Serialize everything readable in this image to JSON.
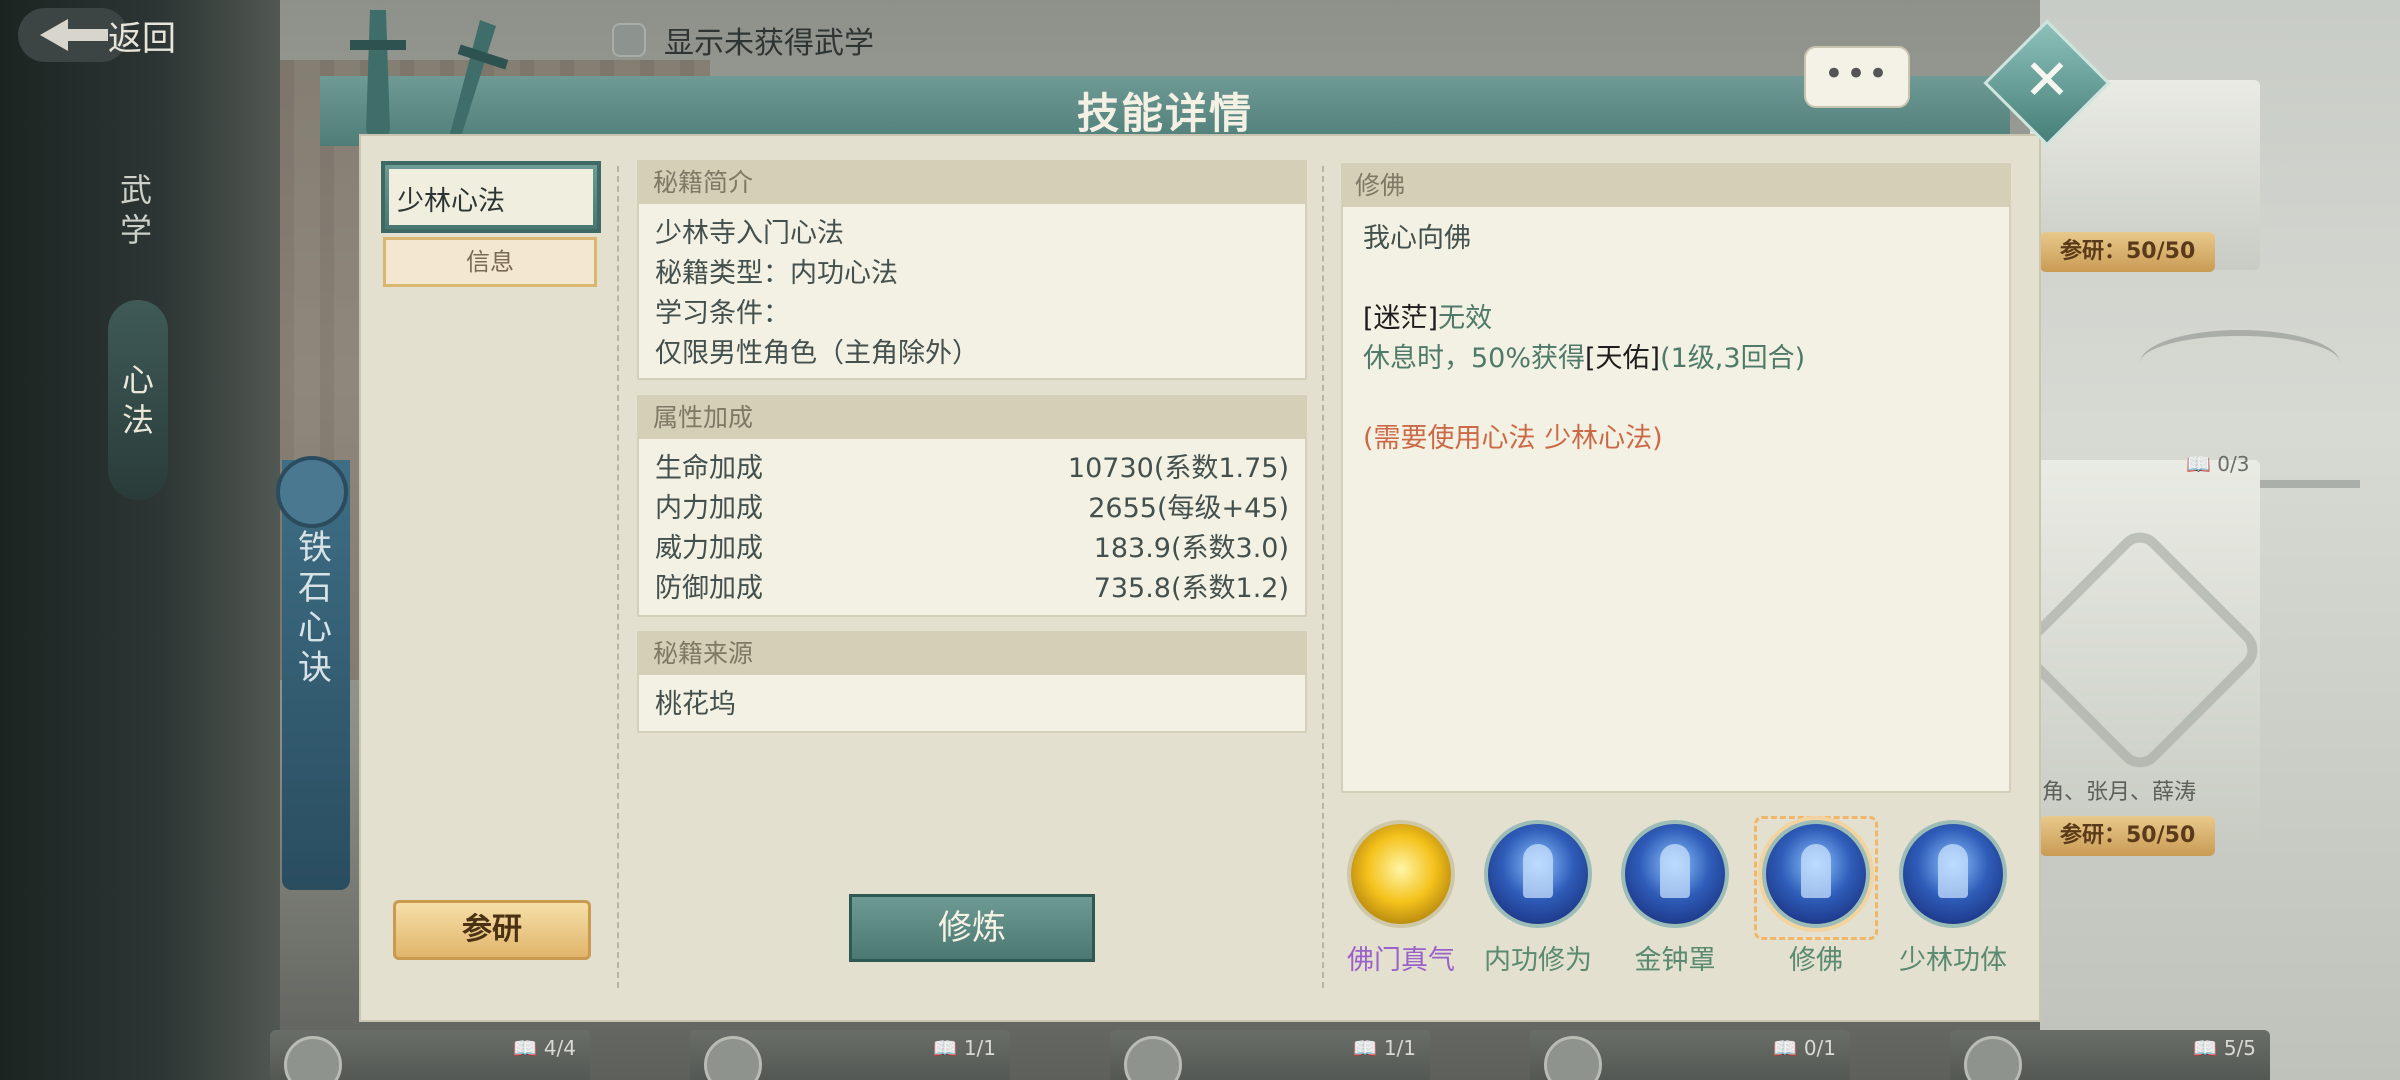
{
  "topbar": {
    "back_label": "返回",
    "toggle_label": "显示未获得武学"
  },
  "left_nav": {
    "items": [
      "武",
      "学"
    ],
    "active": [
      "心",
      "法"
    ]
  },
  "left_card": {
    "name_chars": [
      "铁",
      "石",
      "心",
      "诀"
    ]
  },
  "background_cards": {
    "card1_badge": "参研：50/50",
    "card2_count": "0/3",
    "card2_names": "角、张月、薛涛",
    "card2_badge": "参研：50/50",
    "bottom_counts": [
      "4/4",
      "1/1",
      "1/1",
      "0/1",
      "5/5"
    ]
  },
  "dialog": {
    "title": "技能详情",
    "tabs": {
      "skill": "少林心法",
      "info": "信息"
    },
    "canyan_button": "参研",
    "xiulian_button": "修炼",
    "intro": {
      "header": "秘籍简介",
      "lines": [
        "少林寺入门心法",
        "秘籍类型：内功心法",
        "学习条件：",
        "仅限男性角色（主角除外）"
      ]
    },
    "attributes": {
      "header": "属性加成",
      "rows": [
        {
          "label": "生命加成",
          "value": "10730",
          "note": "(系数1.75)"
        },
        {
          "label": "内力加成",
          "value": "2655",
          "note": "(每级+45)"
        },
        {
          "label": "威力加成",
          "value": "183.9",
          "note": "(系数3.0)"
        },
        {
          "label": "防御加成",
          "value": "735.8",
          "note": "(系数1.2)"
        }
      ]
    },
    "source": {
      "header": "秘籍来源",
      "value": "桃花坞"
    },
    "detail": {
      "header": "修佛",
      "line1": "我心向佛",
      "line3_bracket": "[迷茫]",
      "line3_rest": "无效",
      "line4_pre": "休息时，50%获得",
      "line4_bracket": "[天佑]",
      "line4_post": "(1级,3回合)",
      "requirement": "(需要使用心法 少林心法)"
    },
    "skills": [
      {
        "label": "佛门真气",
        "icon": "golden-orb-icon"
      },
      {
        "label": "内功修为",
        "icon": "meditation-icon"
      },
      {
        "label": "金钟罩",
        "icon": "meditation-icon"
      },
      {
        "label": "修佛",
        "icon": "meditation-icon",
        "selected": true
      },
      {
        "label": "少林功体",
        "icon": "meditation-icon"
      }
    ]
  }
}
